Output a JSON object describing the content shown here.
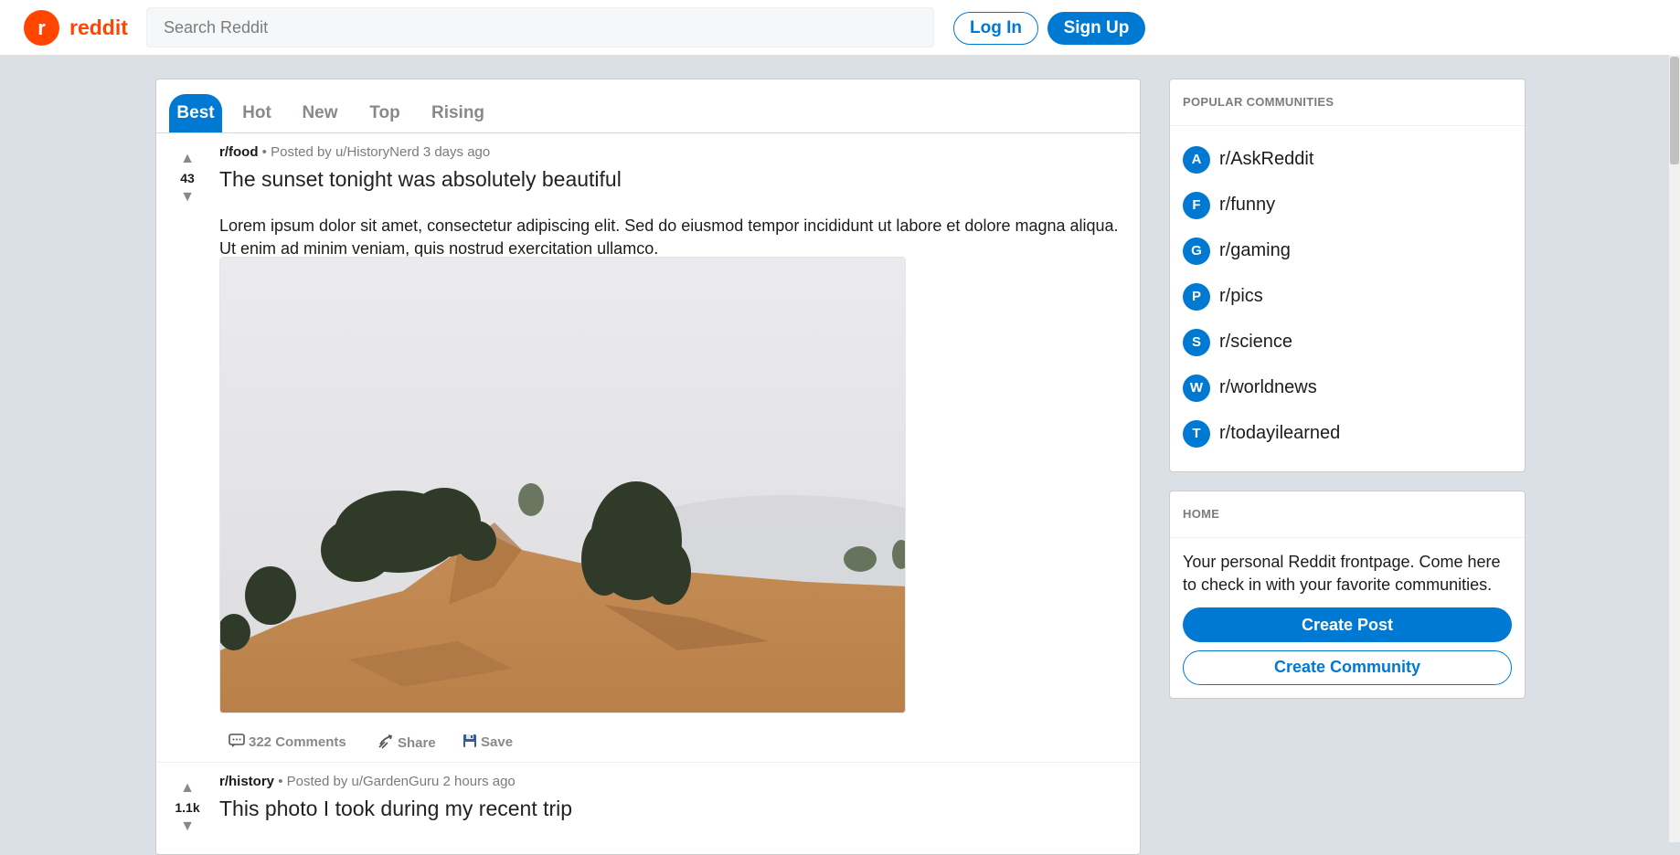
{
  "header": {
    "logo_letter": "r",
    "logo_text": "reddit",
    "search_placeholder": "Search Reddit",
    "login_label": "Log In",
    "signup_label": "Sign Up"
  },
  "feed": {
    "tabs": [
      {
        "label": "Best",
        "active": true
      },
      {
        "label": "Hot",
        "active": false
      },
      {
        "label": "New",
        "active": false
      },
      {
        "label": "Top",
        "active": false
      },
      {
        "label": "Rising",
        "active": false
      }
    ],
    "posts": [
      {
        "subreddit": "r/food",
        "posted_by": "• Posted by u/HistoryNerd 3 days ago",
        "score": "43",
        "title": "The sunset tonight was absolutely beautiful",
        "body": "Lorem ipsum dolor sit amet, consectetur adipiscing elit. Sed do eiusmod tempor incididunt ut labore et dolore magna aliqua. Ut enim ad minim veniam, quis nostrud exercitation ullamco.",
        "comments_label": "322 Comments",
        "share_label": "Share",
        "save_label": "Save"
      },
      {
        "subreddit": "r/history",
        "posted_by": "• Posted by u/GardenGuru 2 hours ago",
        "score": "1.1k",
        "title": "This photo I took during my recent trip"
      }
    ],
    "upvote_icon": "▲",
    "downvote_icon": "▼"
  },
  "sidebar": {
    "popular": {
      "title": "POPULAR COMMUNITIES",
      "communities": [
        {
          "letter": "A",
          "name": "r/AskReddit"
        },
        {
          "letter": "F",
          "name": "r/funny"
        },
        {
          "letter": "G",
          "name": "r/gaming"
        },
        {
          "letter": "P",
          "name": "r/pics"
        },
        {
          "letter": "S",
          "name": "r/science"
        },
        {
          "letter": "W",
          "name": "r/worldnews"
        },
        {
          "letter": "T",
          "name": "r/todayilearned"
        }
      ]
    },
    "home": {
      "title": "HOME",
      "description": "Your personal Reddit frontpage. Come here to check in with your favorite communities.",
      "create_post_label": "Create Post",
      "create_community_label": "Create Community"
    }
  },
  "colors": {
    "brand": "#ff4500",
    "accent": "#0079d3",
    "background": "#dae0e6"
  }
}
